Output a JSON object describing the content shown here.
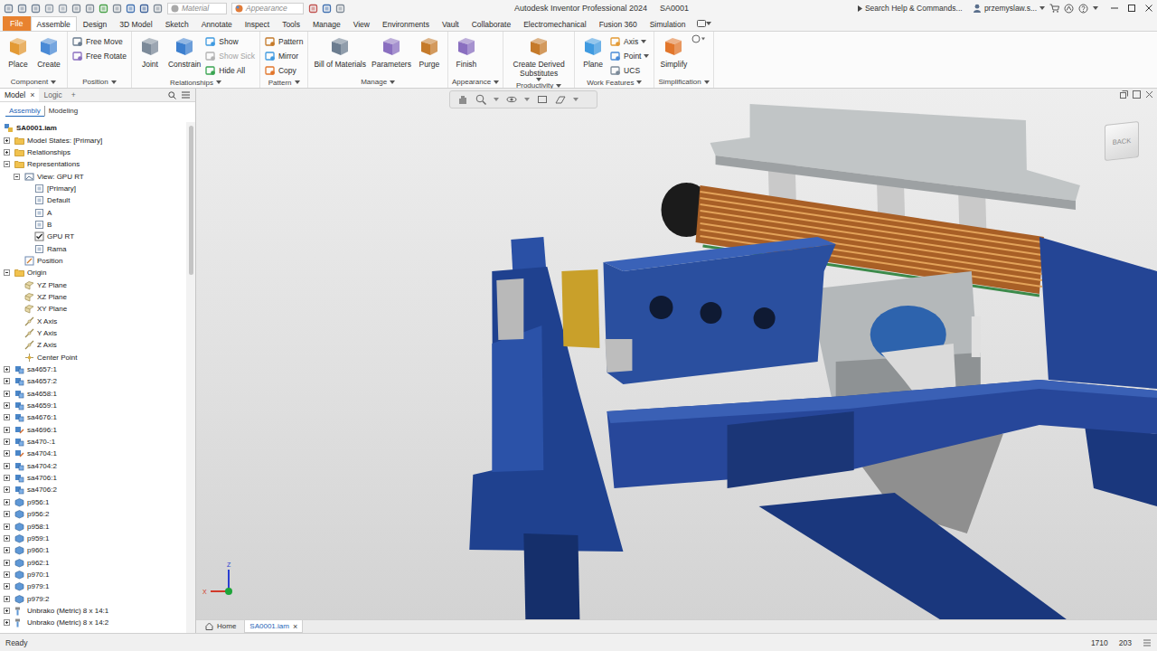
{
  "window": {
    "title": "Autodesk Inventor Professional 2024",
    "document": "SA0001"
  },
  "quick_access": {
    "material": "Material",
    "appearance": "Appearance"
  },
  "search": {
    "placeholder": "Search Help & Commands..."
  },
  "user": {
    "name": "przemyslaw.s..."
  },
  "file_button": "File",
  "ribbon_tabs": [
    {
      "label": "Assemble",
      "selected": true
    },
    {
      "label": "Design",
      "selected": false
    },
    {
      "label": "3D Model",
      "selected": false
    },
    {
      "label": "Sketch",
      "selected": false
    },
    {
      "label": "Annotate",
      "selected": false
    },
    {
      "label": "Inspect",
      "selected": false
    },
    {
      "label": "Tools",
      "selected": false
    },
    {
      "label": "Manage",
      "selected": false
    },
    {
      "label": "View",
      "selected": false
    },
    {
      "label": "Environments",
      "selected": false
    },
    {
      "label": "Vault",
      "selected": false
    },
    {
      "label": "Collaborate",
      "selected": false
    },
    {
      "label": "Electromechanical",
      "selected": false
    },
    {
      "label": "Fusion 360",
      "selected": false
    },
    {
      "label": "Simulation",
      "selected": false
    }
  ],
  "ribbon_groups": [
    {
      "label": "Component",
      "tools": [
        {
          "label": "Place",
          "kind": "large",
          "disabled": false,
          "dropdown": false
        },
        {
          "label": "Create",
          "kind": "large",
          "disabled": false,
          "dropdown": false
        }
      ]
    },
    {
      "label": "Position",
      "tools": [
        {
          "label": "Free Move",
          "kind": "small",
          "disabled": false,
          "dropdown": false
        },
        {
          "label": "Free Rotate",
          "kind": "small",
          "disabled": false,
          "dropdown": false
        }
      ]
    },
    {
      "label": "Relationships",
      "tools": [
        {
          "label": "Joint",
          "kind": "large",
          "disabled": false,
          "dropdown": false
        },
        {
          "label": "Constrain",
          "kind": "large",
          "disabled": false,
          "dropdown": false
        },
        {
          "label": "Show",
          "kind": "small",
          "disabled": false,
          "dropdown": false
        },
        {
          "label": "Show Sick",
          "kind": "small",
          "disabled": true,
          "dropdown": false
        },
        {
          "label": "Hide All",
          "kind": "small",
          "disabled": false,
          "dropdown": false
        }
      ]
    },
    {
      "label": "Pattern",
      "tools": [
        {
          "label": "Pattern",
          "kind": "small",
          "disabled": false,
          "dropdown": false
        },
        {
          "label": "Mirror",
          "kind": "small",
          "disabled": false,
          "dropdown": false
        },
        {
          "label": "Copy",
          "kind": "small",
          "disabled": false,
          "dropdown": false
        }
      ]
    },
    {
      "label": "Manage",
      "tools": [
        {
          "label": "Bill of Materials",
          "kind": "large",
          "disabled": false,
          "dropdown": false
        },
        {
          "label": "Parameters",
          "kind": "large",
          "disabled": false,
          "dropdown": false
        },
        {
          "label": "Purge",
          "kind": "large",
          "disabled": false,
          "dropdown": false
        }
      ]
    },
    {
      "label": "Appearance",
      "tools": [
        {
          "label": "Finish",
          "kind": "large",
          "disabled": false,
          "dropdown": false
        }
      ]
    },
    {
      "label": "Productivity",
      "tools": [
        {
          "label": "Create Derived Substitutes",
          "kind": "large",
          "disabled": false,
          "dropdown": true
        }
      ]
    },
    {
      "label": "Work Features",
      "tools": [
        {
          "label": "Plane",
          "kind": "large",
          "disabled": false,
          "dropdown": false
        },
        {
          "label": "Axis",
          "kind": "small",
          "disabled": false,
          "dropdown": true
        },
        {
          "label": "Point",
          "kind": "small",
          "disabled": false,
          "dropdown": true
        },
        {
          "label": "UCS",
          "kind": "small",
          "disabled": false,
          "dropdown": false
        }
      ]
    },
    {
      "label": "Simplification",
      "tools": [
        {
          "label": "Simplify",
          "kind": "large",
          "disabled": false,
          "dropdown": false
        }
      ]
    }
  ],
  "browser": {
    "tabs": [
      {
        "label": "Model",
        "selected": true,
        "closable": true
      },
      {
        "label": "Logic",
        "selected": false,
        "closable": false
      }
    ],
    "close_glyph": "×",
    "add_glyph": "+",
    "views": [
      {
        "label": "Assembly",
        "selected": true
      },
      {
        "label": "Modeling",
        "selected": false
      }
    ]
  },
  "tree": [
    {
      "label": "SA0001.iam",
      "level": 0,
      "kind": "assembly",
      "expandable": false,
      "expanded": false,
      "checked": false
    },
    {
      "label": "Model States: [Primary]",
      "level": 1,
      "kind": "folder",
      "expandable": true,
      "expanded": false,
      "checked": false
    },
    {
      "label": "Relationships",
      "level": 1,
      "kind": "folder",
      "expandable": true,
      "expanded": false,
      "checked": false
    },
    {
      "label": "Representations",
      "level": 1,
      "kind": "folder",
      "expandable": true,
      "expanded": true,
      "checked": false
    },
    {
      "label": "View: GPU RT",
      "level": 2,
      "kind": "view",
      "expandable": true,
      "expanded": true,
      "checked": false
    },
    {
      "label": "[Primary]",
      "level": 3,
      "kind": "design-view",
      "expandable": false,
      "expanded": false,
      "checked": false
    },
    {
      "label": "Default",
      "level": 3,
      "kind": "design-view",
      "expandable": false,
      "expanded": false,
      "checked": false
    },
    {
      "label": "A",
      "level": 3,
      "kind": "design-view",
      "expandable": false,
      "expanded": false,
      "checked": false
    },
    {
      "label": "B",
      "level": 3,
      "kind": "design-view",
      "expandable": false,
      "expanded": false,
      "checked": false
    },
    {
      "label": "GPU RT",
      "level": 3,
      "kind": "design-view",
      "expandable": false,
      "expanded": false,
      "checked": true
    },
    {
      "label": "Rama",
      "level": 3,
      "kind": "design-view",
      "expandable": false,
      "expanded": false,
      "checked": false
    },
    {
      "label": "Position",
      "level": 2,
      "kind": "position",
      "expandable": false,
      "expanded": false,
      "checked": false
    },
    {
      "label": "Origin",
      "level": 1,
      "kind": "folder",
      "expandable": true,
      "expanded": true,
      "checked": false
    },
    {
      "label": "YZ Plane",
      "level": 2,
      "kind": "plane",
      "expandable": false,
      "expanded": false,
      "checked": false
    },
    {
      "label": "XZ Plane",
      "level": 2,
      "kind": "plane",
      "expandable": false,
      "expanded": false,
      "checked": false
    },
    {
      "label": "XY Plane",
      "level": 2,
      "kind": "plane",
      "expandable": false,
      "expanded": false,
      "checked": false
    },
    {
      "label": "X Axis",
      "level": 2,
      "kind": "axis",
      "expandable": false,
      "expanded": false,
      "checked": false
    },
    {
      "label": "Y Axis",
      "level": 2,
      "kind": "axis",
      "expandable": false,
      "expanded": false,
      "checked": false
    },
    {
      "label": "Z Axis",
      "level": 2,
      "kind": "axis",
      "expandable": false,
      "expanded": false,
      "checked": false
    },
    {
      "label": "Center Point",
      "level": 2,
      "kind": "point",
      "expandable": false,
      "expanded": false,
      "checked": false
    },
    {
      "label": "sa4657:1",
      "level": 1,
      "kind": "subassembly",
      "expandable": true,
      "expanded": false,
      "checked": false
    },
    {
      "label": "sa4657:2",
      "level": 1,
      "kind": "subassembly",
      "expandable": true,
      "expanded": false,
      "checked": false
    },
    {
      "label": "sa4658:1",
      "level": 1,
      "kind": "subassembly",
      "expandable": true,
      "expanded": false,
      "checked": false
    },
    {
      "label": "sa4659:1",
      "level": 1,
      "kind": "subassembly",
      "expandable": true,
      "expanded": false,
      "checked": false
    },
    {
      "label": "sa4676:1",
      "level": 1,
      "kind": "subassembly",
      "expandable": true,
      "expanded": false,
      "checked": false
    },
    {
      "label": "sa4696:1",
      "level": 1,
      "kind": "flexible",
      "expandable": true,
      "expanded": false,
      "checked": false
    },
    {
      "label": "sa470-:1",
      "level": 1,
      "kind": "subassembly",
      "expandable": true,
      "expanded": false,
      "checked": false
    },
    {
      "label": "sa4704:1",
      "level": 1,
      "kind": "flexible",
      "expandable": true,
      "expanded": false,
      "checked": false
    },
    {
      "label": "sa4704:2",
      "level": 1,
      "kind": "subassembly",
      "expandable": true,
      "expanded": false,
      "checked": false
    },
    {
      "label": "sa4706:1",
      "level": 1,
      "kind": "subassembly",
      "expandable": true,
      "expanded": false,
      "checked": false
    },
    {
      "label": "sa4706:2",
      "level": 1,
      "kind": "subassembly",
      "expandable": true,
      "expanded": false,
      "checked": false
    },
    {
      "label": "p956:1",
      "level": 1,
      "kind": "part",
      "expandable": true,
      "expanded": false,
      "checked": false
    },
    {
      "label": "p956:2",
      "level": 1,
      "kind": "part",
      "expandable": true,
      "expanded": false,
      "checked": false
    },
    {
      "label": "p958:1",
      "level": 1,
      "kind": "part",
      "expandable": true,
      "expanded": false,
      "checked": false
    },
    {
      "label": "p959:1",
      "level": 1,
      "kind": "part",
      "expandable": true,
      "expanded": false,
      "checked": false
    },
    {
      "label": "p960:1",
      "level": 1,
      "kind": "part",
      "expandable": true,
      "expanded": false,
      "checked": false
    },
    {
      "label": "p962:1",
      "level": 1,
      "kind": "part",
      "expandable": true,
      "expanded": false,
      "checked": false
    },
    {
      "label": "p970:1",
      "level": 1,
      "kind": "part",
      "expandable": true,
      "expanded": false,
      "checked": false
    },
    {
      "label": "p979:1",
      "level": 1,
      "kind": "part",
      "expandable": true,
      "expanded": false,
      "checked": false
    },
    {
      "label": "p979:2",
      "level": 1,
      "kind": "part",
      "expandable": true,
      "expanded": false,
      "checked": false
    },
    {
      "label": "Unbrako (Metric) 8 x  14:1",
      "level": 1,
      "kind": "fastener",
      "expandable": true,
      "expanded": false,
      "checked": false
    },
    {
      "label": "Unbrako (Metric) 8 x  14:2",
      "level": 1,
      "kind": "fastener",
      "expandable": true,
      "expanded": false,
      "checked": false
    }
  ],
  "viewcube": {
    "label": "BACK"
  },
  "triad": {
    "z": "Z",
    "x": "X"
  },
  "doc_tabs": {
    "close_glyph": "×",
    "tabs": [
      {
        "label": "Home",
        "selected": false,
        "closable": false
      },
      {
        "label": "SA0001.iam",
        "selected": true,
        "closable": true
      }
    ]
  },
  "status_bar": {
    "text": "Ready",
    "coords": [
      "1710",
      "203"
    ]
  }
}
